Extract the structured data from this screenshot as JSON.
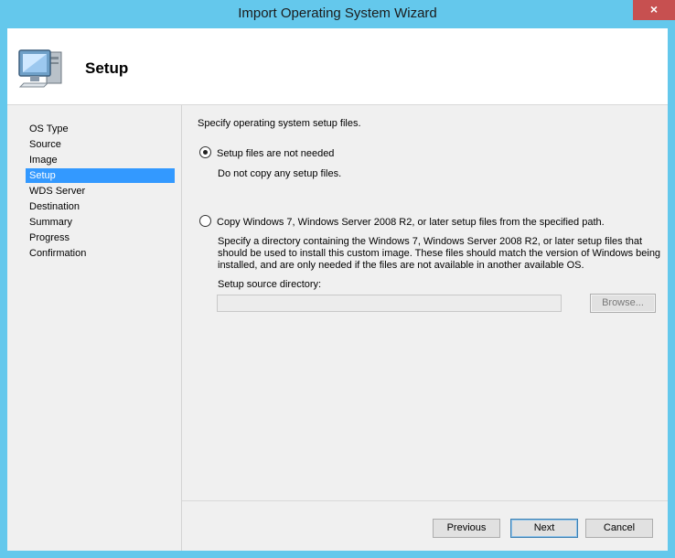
{
  "window": {
    "title": "Import Operating System Wizard",
    "close_glyph": "×"
  },
  "header": {
    "title": "Setup",
    "icon": "computer-icon"
  },
  "nav": {
    "items": [
      {
        "label": "OS Type",
        "active": false
      },
      {
        "label": "Source",
        "active": false
      },
      {
        "label": "Image",
        "active": false
      },
      {
        "label": "Setup",
        "active": true
      },
      {
        "label": "WDS Server",
        "active": false
      },
      {
        "label": "Destination",
        "active": false
      },
      {
        "label": "Summary",
        "active": false
      },
      {
        "label": "Progress",
        "active": false
      },
      {
        "label": "Confirmation",
        "active": false
      }
    ]
  },
  "content": {
    "intro": "Specify operating system setup files.",
    "option1": {
      "label": "Setup files are not needed",
      "description": "Do not copy any setup files.",
      "selected": true
    },
    "option2": {
      "label": "Copy Windows 7, Windows Server 2008 R2, or later setup files from the specified path.",
      "description_lines": [
        "Specify a directory containing the Windows 7, Windows Server 2008 R2, or later setup files that",
        "should be used to install this custom image.  These files should match the version of Windows being",
        "installed, and are only needed if the files are not available in another available OS."
      ],
      "selected": false
    },
    "source_dir_label": "Setup source directory:",
    "source_dir_value": "",
    "browse_label": "Browse..."
  },
  "buttons": {
    "previous": "Previous",
    "next": "Next",
    "cancel": "Cancel"
  },
  "colors": {
    "frame": "#64c8ec",
    "selection": "#3399ff",
    "close": "#c75050"
  }
}
